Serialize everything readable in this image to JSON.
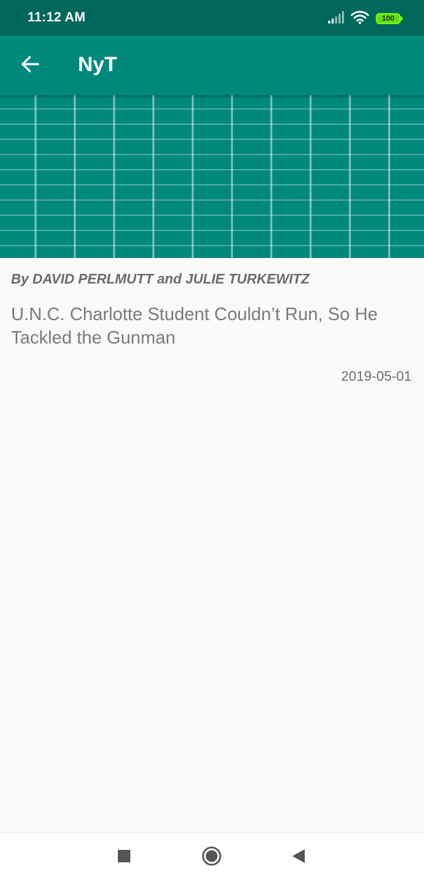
{
  "status_bar": {
    "time": "11:12 AM",
    "battery_level": "100",
    "icons": [
      "signal-icon",
      "wifi-icon",
      "battery-icon"
    ]
  },
  "app_bar": {
    "title": "NyT",
    "back_icon": "arrow-left-icon"
  },
  "article": {
    "byline": "By DAVID PERLMUTT and JULIE TURKEWITZ",
    "headline": "U.N.C. Charlotte Student Couldn’t Run, So He Tackled the Gunman",
    "date": "2019-05-01"
  },
  "nav_bar": {
    "icons": [
      "recents-square-icon",
      "home-circle-icon",
      "back-triangle-icon"
    ]
  },
  "colors": {
    "status_bar": "#00675b",
    "app_bar": "#00897b",
    "background": "#fafafa"
  }
}
